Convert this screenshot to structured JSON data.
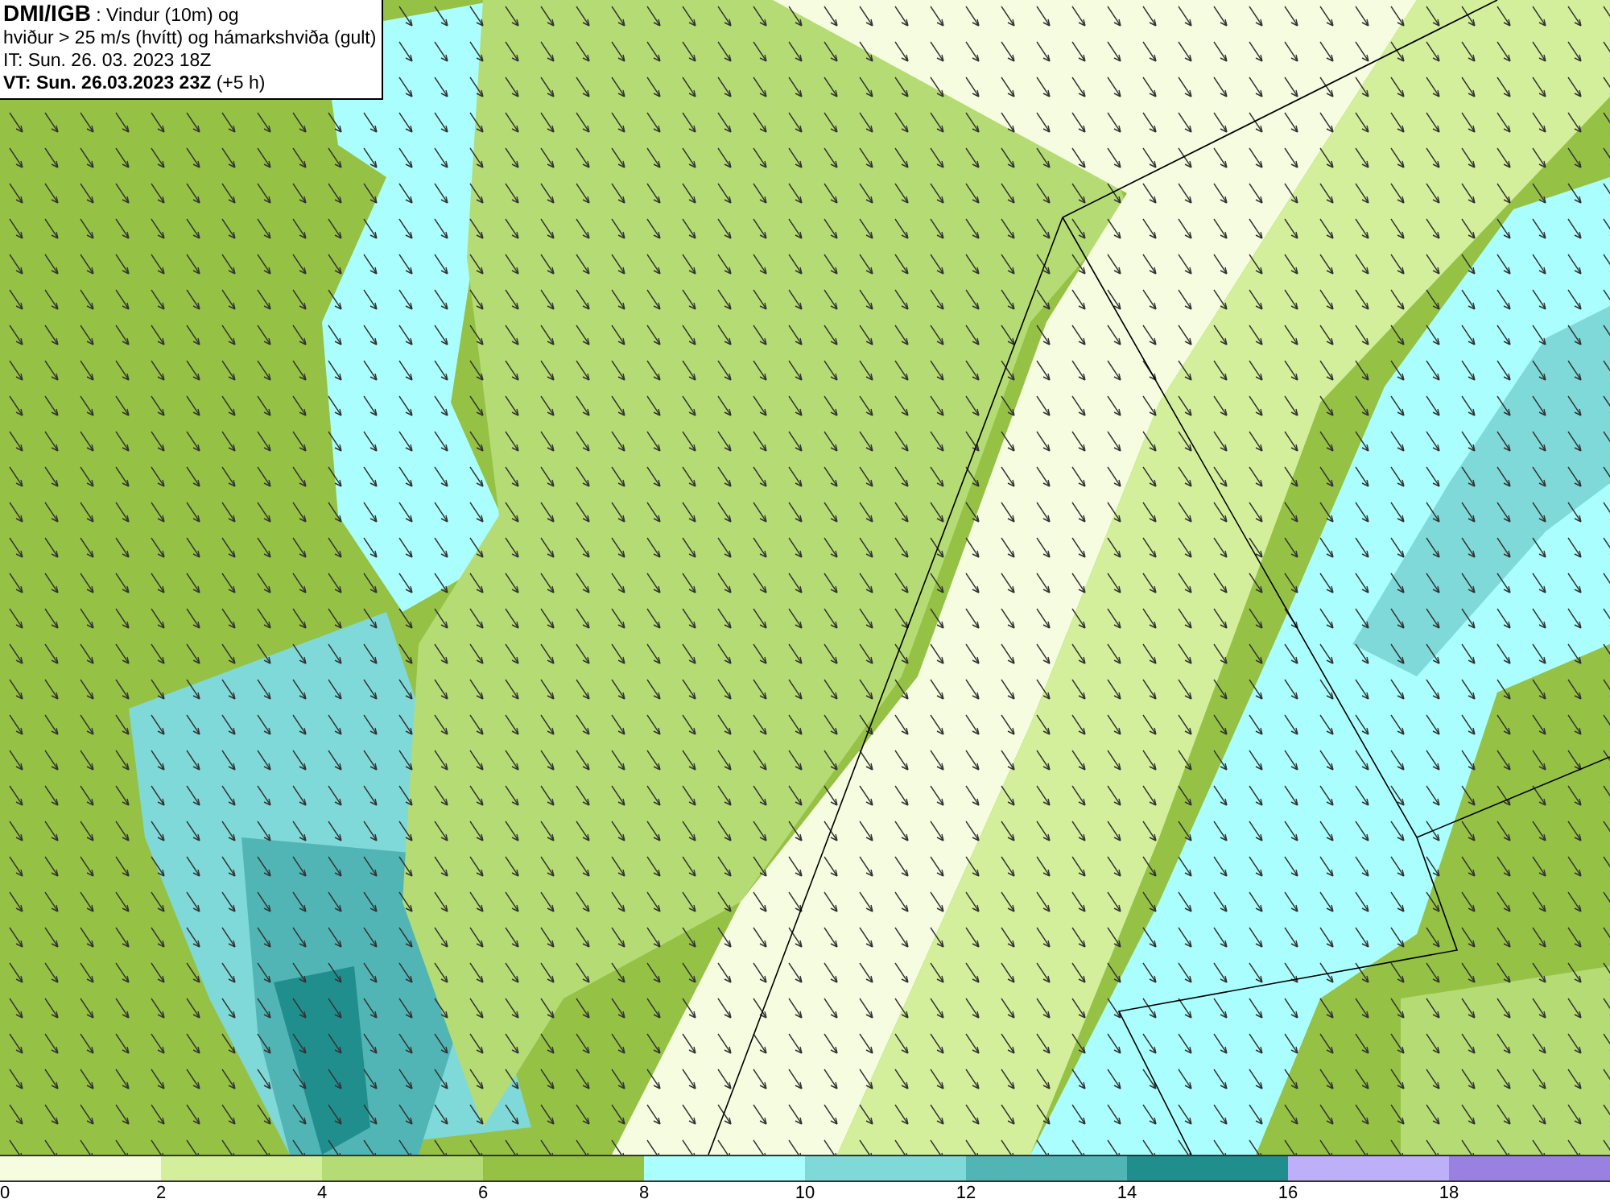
{
  "header": {
    "lines": [
      "**DMI/IGB** : Vindur (10m) og",
      "hviður > 25 m/s (hvítt) og hámarkshviða (gult)",
      "IT: Sun. 26. 03. 2023 18Z",
      "**VT: Sun. 26.03.2023 23Z** (+5 h)"
    ]
  },
  "legend": {
    "bins": [
      {
        "color": "#f5fce0"
      },
      {
        "color": "#d4ef9c"
      },
      {
        "color": "#b5dc74"
      },
      {
        "color": "#95c245"
      },
      {
        "color": "#aafffe"
      },
      {
        "color": "#80d9d9"
      },
      {
        "color": "#52b5b5"
      },
      {
        "color": "#218e8e"
      },
      {
        "color": "#beb0f8"
      },
      {
        "color": "#9a80e0"
      }
    ],
    "ticks": [
      "0",
      "2",
      "4",
      "6",
      "8",
      "10",
      "12",
      "14",
      "16",
      "18"
    ]
  }
}
